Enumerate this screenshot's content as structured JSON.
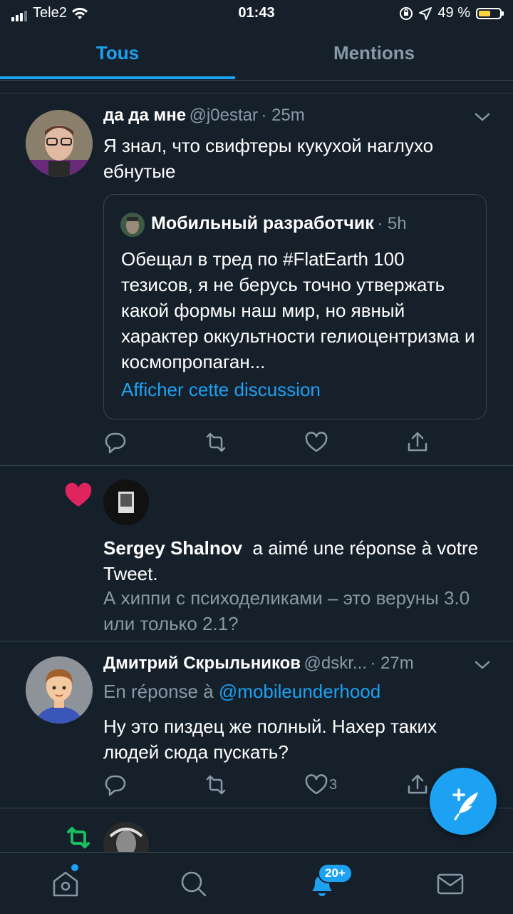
{
  "status_bar": {
    "carrier": "Tele2",
    "time": "01:43",
    "battery": "49 %",
    "battery_level": 0.49
  },
  "tabs": [
    {
      "label": "Tous",
      "active": true
    },
    {
      "label": "Mentions",
      "active": false
    }
  ],
  "tweet1": {
    "name": "да да мне",
    "handle": "@j0estar",
    "time": "· 25m",
    "text": "Я знал, что свифтеры кукухой наглухо ебнутые",
    "quote": {
      "name": "Мобильный разработчик",
      "time": "· 5h",
      "text": "Обещал в тред по #FlatEarth 100 тезисов, я не берусь точно утвержать какой формы наш мир, но явный характер оккультности гелиоцентризма и космопропаган...",
      "show_thread": "Afficher cette discussion"
    }
  },
  "like_notification": {
    "name": "Sergey Shalnov",
    "action": "a aimé une réponse à votre Tweet.",
    "text": "А хиппи с психоделиками – это веруны 3.0 или только 2.1?"
  },
  "tweet2": {
    "name": "Дмитрий Скрыльников",
    "handle": "@dskr...",
    "time": "· 27m",
    "reply_prefix": "En réponse à",
    "reply_to": "@mobileunderhood",
    "text": "Ну это пиздец же полный. Нахер таких людей сюда пускать?",
    "like_count": "3"
  },
  "bottom_nav": {
    "notifications_badge": "20+"
  },
  "colors": {
    "background": "#15202b",
    "accent": "#1da1f2",
    "muted": "#8899a6",
    "like": "#e0245e",
    "retweet": "#17bf63"
  }
}
